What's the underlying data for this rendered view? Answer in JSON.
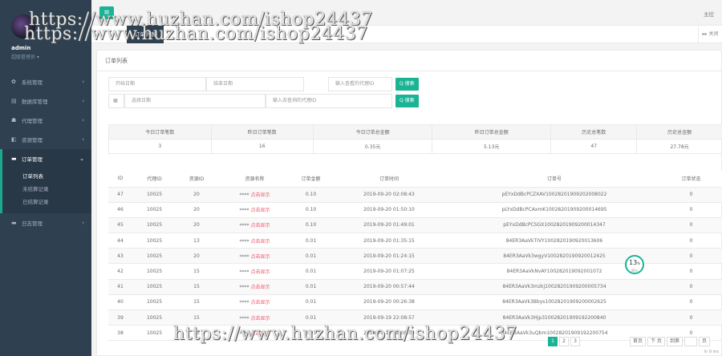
{
  "sidebar": {
    "admin_name": "admin",
    "admin_role": "超级管理员 ▾",
    "items": [
      {
        "icon": "gear-icon",
        "glyph": "✿",
        "label": "系统管理"
      },
      {
        "icon": "database-icon",
        "glyph": "▤",
        "label": "数据库管理"
      },
      {
        "icon": "users-icon",
        "glyph": "☗",
        "label": "代理管理"
      },
      {
        "icon": "resource-icon",
        "glyph": "◧",
        "label": "资源管理"
      },
      {
        "icon": "order-icon",
        "glyph": "▬",
        "label": "订单管理"
      },
      {
        "icon": "log-icon",
        "glyph": "▬",
        "label": "日志管理"
      }
    ],
    "subitems": [
      "订单列表",
      "未结算记录",
      "已结算记录"
    ]
  },
  "top": {
    "right_text": "主控",
    "tab_label": "订单列表",
    "more_label": "关闭"
  },
  "page_title": "订单列表",
  "filters": {
    "start_date": "开始日期",
    "end_date": "结束日期",
    "agent_id_placeholder": "输入查看的代理ID",
    "search_label": "搜索",
    "select_date": "选择日期",
    "agent_id2_placeholder": "输入去查询的代理ID",
    "search_label2": "搜索"
  },
  "stats": {
    "headers": [
      "今日订单笔数",
      "昨日订单笔数",
      "今日订单总金额",
      "昨日订单总金额",
      "历史总笔数",
      "历史总金额"
    ],
    "values": [
      "3",
      "16",
      "0.35元",
      "5.13元",
      "47",
      "27.78元"
    ]
  },
  "orders": {
    "headers": [
      "ID",
      "代理ID",
      "资源ID",
      "资源名称",
      "订单金额",
      "订单时间",
      "订单号",
      "订单状态"
    ],
    "rows": [
      [
        "47",
        "10025",
        "20",
        "****",
        "点击显示",
        "0.10",
        "2019-09-20 02:08:43",
        "pEYxDdBcPCZXAV10028201909202008022",
        "0"
      ],
      [
        "46",
        "10025",
        "20",
        "****",
        "点击显示",
        "0.10",
        "2019-09-20 01:50:10",
        "pLYxDdBcPCAxmK10028201909200014695",
        "0"
      ],
      [
        "45",
        "10025",
        "20",
        "****",
        "点击显示",
        "0.10",
        "2019-09-20 01:49:01",
        "pEYxDdBcPCSGX10028201909200014347",
        "0"
      ],
      [
        "44",
        "10025",
        "13",
        "****",
        "点击显示",
        "0.01",
        "2019-09-20 01:35:15",
        "84ER3AaVkTIVY1002820190920013606",
        "0"
      ],
      [
        "43",
        "10025",
        "20",
        "****",
        "点击显示",
        "0.01",
        "2019-09-20 01:24:15",
        "84ER3AaVk3wgyV1002820190920012425",
        "0"
      ],
      [
        "42",
        "10025",
        "15",
        "****",
        "点击显示",
        "0.01",
        "2019-09-20 01:07:25",
        "84ER3AaVkNvAY100282019092001072",
        "0"
      ],
      [
        "41",
        "10025",
        "15",
        "****",
        "点击显示",
        "0.01",
        "2019-09-20 00:57:44",
        "84ER3AaVk3mzkj10028201909200005734",
        "0"
      ],
      [
        "40",
        "10025",
        "15",
        "****",
        "点击显示",
        "0.01",
        "2019-09-20 00:26:38",
        "84ER3AaVk3Bbys10028201909200002625",
        "0"
      ],
      [
        "39",
        "10025",
        "15",
        "****",
        "点击显示",
        "0.01",
        "2019-09-19 22:08:57",
        "84ER3AaVk3Hjp310028201909192200840",
        "0"
      ],
      [
        "38",
        "10025",
        "13",
        "****",
        "点击显示",
        "0.01",
        "2019-09-19 22:08:03",
        "84ER3AaVk3uQbm10028201909192200754",
        "0"
      ]
    ]
  },
  "pager": {
    "pages": [
      "1",
      "2",
      "3"
    ],
    "prev": "首页",
    "next": "下 页",
    "goto": "到第",
    "page": "页"
  },
  "badge": {
    "value": "13",
    "unit": "%",
    "sub": "0K/s"
  },
  "footer": "in 9 ms",
  "watermark": "https://www.huzhan.com/ishop24437",
  "colors": {
    "primary": "#1ab394",
    "sidebar": "#2f4050",
    "link_red": "#ed5565"
  }
}
